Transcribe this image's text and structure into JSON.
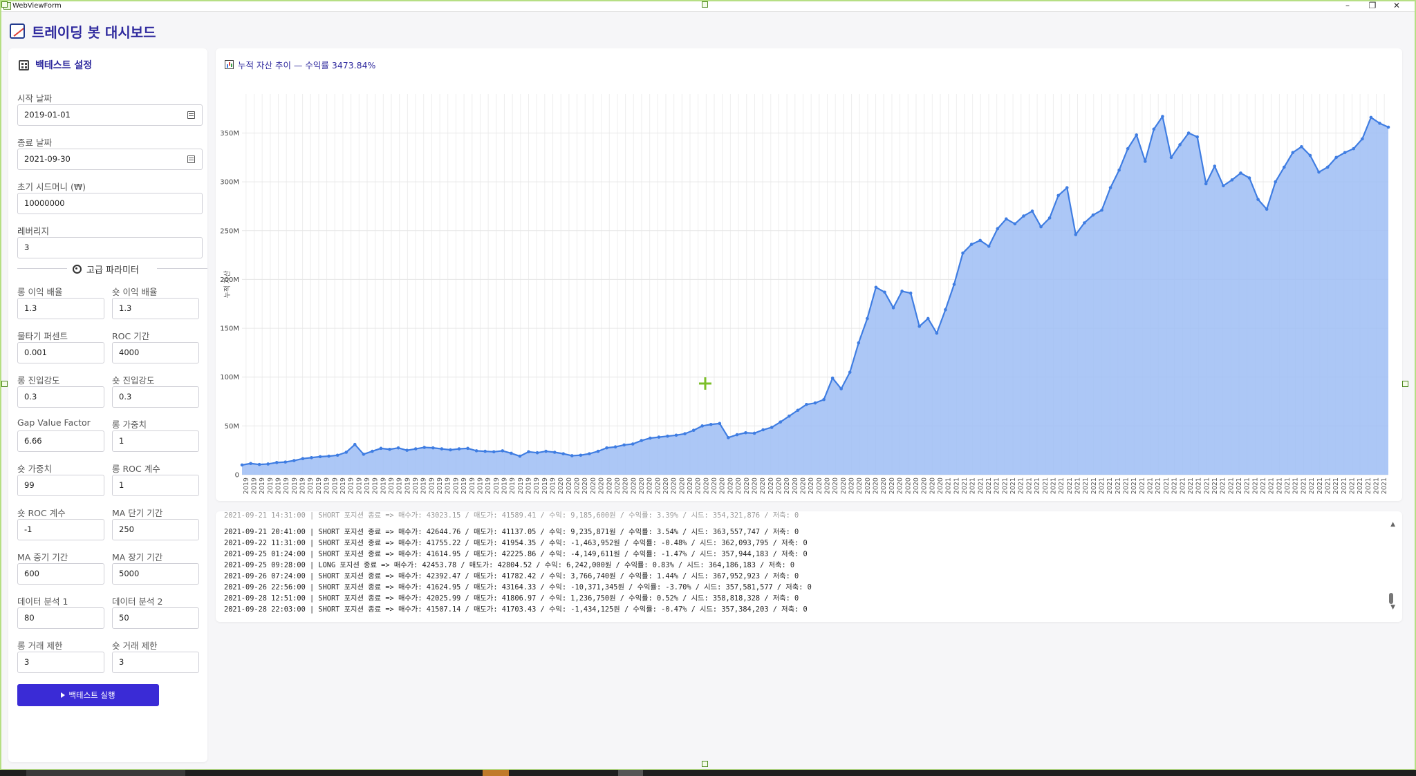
{
  "window": {
    "title": "WebViewForm",
    "minimize": "–",
    "restore": "❐",
    "close": "✕"
  },
  "app": {
    "title": "트레이딩 봇 대시보드"
  },
  "sidebar": {
    "title": "백테스트 설정",
    "start_date": {
      "label": "시작 날짜",
      "value": "2019-01-01"
    },
    "end_date": {
      "label": "종료 날짜",
      "value": "2021-09-30"
    },
    "seed": {
      "label": "초기 시드머니 (₩)",
      "value": "10000000"
    },
    "leverage": {
      "label": "레버리지",
      "value": "3"
    },
    "advanced_label": "고급 파라미터",
    "params": [
      {
        "label": "롱 이익 배율",
        "value": "1.3"
      },
      {
        "label": "숏 이익 배율",
        "value": "1.3"
      },
      {
        "label": "물타기 퍼센트",
        "value": "0.001"
      },
      {
        "label": "ROC 기간",
        "value": "4000"
      },
      {
        "label": "롱 진입강도",
        "value": "0.3"
      },
      {
        "label": "숏 진입강도",
        "value": "0.3"
      },
      {
        "label": "Gap Value Factor",
        "value": "6.66"
      },
      {
        "label": "롱 가중치",
        "value": "1"
      },
      {
        "label": "숏 가중치",
        "value": "99"
      },
      {
        "label": "롱 ROC 계수",
        "value": "1"
      },
      {
        "label": "숏 ROC 계수",
        "value": "-1"
      },
      {
        "label": "MA 단기 기간",
        "value": "250"
      },
      {
        "label": "MA 중기 기간",
        "value": "600"
      },
      {
        "label": "MA 장기 기간",
        "value": "5000"
      },
      {
        "label": "데이터 분석 1",
        "value": "80"
      },
      {
        "label": "데이터 분석 2",
        "value": "50"
      },
      {
        "label": "롱 거래 제한",
        "value": "3"
      },
      {
        "label": "숏 거래 제한",
        "value": "3"
      }
    ],
    "run_button": "백테스트 실행"
  },
  "chart_panel": {
    "title": "누적 자산 추이 — 수익률 3473.84%"
  },
  "chart_data": {
    "type": "area",
    "title": "누적 자산 추이 — 수익률 3473.84%",
    "ylabel": "누적 자산",
    "xlabel": "",
    "ylim": [
      0,
      390000000
    ],
    "yticks": [
      0,
      50000000,
      100000000,
      150000000,
      200000000,
      250000000,
      300000000,
      350000000
    ],
    "ytick_labels": [
      "0",
      "50M",
      "100M",
      "150M",
      "200M",
      "250M",
      "300M",
      "350M"
    ],
    "grid": true,
    "series_color": "#3f7de2",
    "fill_color": "#9ebdf5",
    "x_labels": [
      "2019",
      "2019",
      "2019",
      "2019",
      "2019",
      "2019",
      "2019",
      "2019",
      "2019",
      "2019",
      "2019",
      "2019",
      "2019",
      "2019",
      "2019",
      "2019",
      "2019",
      "2019",
      "2019",
      "2019",
      "2019",
      "2019",
      "2019",
      "2019",
      "2019",
      "2019",
      "2019",
      "2019",
      "2019",
      "2019",
      "2019",
      "2019",
      "2019",
      "2019",
      "2019",
      "2019",
      "2019",
      "2019",
      "2019",
      "2020",
      "2020",
      "2020",
      "2020",
      "2020",
      "2020",
      "2020",
      "2020",
      "2020",
      "2020",
      "2020",
      "2020",
      "2020",
      "2020",
      "2020",
      "2020",
      "2020",
      "2020",
      "2020",
      "2020",
      "2020",
      "2020",
      "2020",
      "2020",
      "2020",
      "2020",
      "2020",
      "2020",
      "2020",
      "2020",
      "2020",
      "2020",
      "2020",
      "2020",
      "2020",
      "2020",
      "2020",
      "2020",
      "2020",
      "2020",
      "2020",
      "2020",
      "2020",
      "2020",
      "2020",
      "2020",
      "2020",
      "2020",
      "2021",
      "2021",
      "2021",
      "2021",
      "2021",
      "2021",
      "2021",
      "2021",
      "2021",
      "2021",
      "2021",
      "2021",
      "2021",
      "2021",
      "2021",
      "2021",
      "2021",
      "2021",
      "2021",
      "2021",
      "2021",
      "2021",
      "2021",
      "2021",
      "2021",
      "2021",
      "2021",
      "2021",
      "2021",
      "2021",
      "2021",
      "2021",
      "2021",
      "2021",
      "2021",
      "2021",
      "2021",
      "2021",
      "2021",
      "2021",
      "2021",
      "2021",
      "2021",
      "2021",
      "2021",
      "2021",
      "2021",
      "2021",
      "2021",
      "2021",
      "2021",
      "2021",
      "2021",
      "2021",
      "2021"
    ],
    "values": [
      10000000,
      11500000,
      10500000,
      11000000,
      12500000,
      13000000,
      14500000,
      16500000,
      17500000,
      18500000,
      19000000,
      20000000,
      23000000,
      31000000,
      21000000,
      24000000,
      27000000,
      26000000,
      27500000,
      25000000,
      26500000,
      28000000,
      27500000,
      26500000,
      25500000,
      26500000,
      27000000,
      24500000,
      24000000,
      23500000,
      24500000,
      22000000,
      19000000,
      23500000,
      22500000,
      24000000,
      23000000,
      21500000,
      19500000,
      20000000,
      21500000,
      24000000,
      27500000,
      28500000,
      30500000,
      31500000,
      35000000,
      37500000,
      38500000,
      39500000,
      40500000,
      42000000,
      45500000,
      50000000,
      51500000,
      52500000,
      38000000,
      41000000,
      43000000,
      42500000,
      46000000,
      48500000,
      54000000,
      60000000,
      66000000,
      72000000,
      73500000,
      77000000,
      99000000,
      88000000,
      105000000,
      135000000,
      160000000,
      192000000,
      187000000,
      171000000,
      188000000,
      186000000,
      152000000,
      160000000,
      145000000,
      169000000,
      195000000,
      227000000,
      236000000,
      240000000,
      234000000,
      252000000,
      262000000,
      257000000,
      265000000,
      270000000,
      254000000,
      263000000,
      286000000,
      294000000,
      246000000,
      258000000,
      266000000,
      271000000,
      294000000,
      312000000,
      334000000,
      348000000,
      321000000,
      354000000,
      367000000,
      325000000,
      338000000,
      350000000,
      346000000,
      298000000,
      316000000,
      296000000,
      302000000,
      309000000,
      304000000,
      282000000,
      272000000,
      300000000,
      315000000,
      330000000,
      336000000,
      327000000,
      310000000,
      315000000,
      325000000,
      330000000,
      334000000,
      344000000,
      366000000,
      360000000,
      356000000
    ]
  },
  "log": {
    "clipped_line": "2021-09-21 14:31:00 | SHORT 포지션 종료 => 매수가: 43023.15 / 매도가: 41589.41 / 수익: 9,185,600원 / 수익률: 3.39% / 시드: 354,321,876 / 저축: 0",
    "lines": [
      "2021-09-21 20:41:00 | SHORT 포지션 종료 => 매수가: 42644.76 / 매도가: 41137.05 / 수익: 9,235,871원 / 수익률: 3.54% / 시드: 363,557,747 / 저축: 0",
      "2021-09-22 11:31:00 | SHORT 포지션 종료 => 매수가: 41755.22 / 매도가: 41954.35 / 수익: -1,463,952원 / 수익률: -0.48% / 시드: 362,093,795 / 저축: 0",
      "2021-09-25 01:24:00 | SHORT 포지션 종료 => 매수가: 41614.95 / 매도가: 42225.86 / 수익: -4,149,611원 / 수익률: -1.47% / 시드: 357,944,183 / 저축: 0",
      "2021-09-25 09:28:00 | LONG 포지션 종료 => 매수가: 42453.78 / 매도가: 42804.52 / 수익: 6,242,000원 / 수익률: 0.83% / 시드: 364,186,183 / 저축: 0",
      "2021-09-26 07:24:00 | SHORT 포지션 종료 => 매수가: 42392.47 / 매도가: 41782.42 / 수익: 3,766,740원 / 수익률: 1.44% / 시드: 367,952,923 / 저축: 0",
      "2021-09-26 22:56:00 | SHORT 포지션 종료 => 매수가: 41624.95 / 매도가: 43164.33 / 수익: -10,371,345원 / 수익률: -3.70% / 시드: 357,581,577 / 저축: 0",
      "2021-09-28 12:51:00 | SHORT 포지션 종료 => 매수가: 42025.99 / 매도가: 41806.97 / 수익: 1,236,750원 / 수익률: 0.52% / 시드: 358,818,328 / 저축: 0",
      "2021-09-28 22:03:00 | SHORT 포지션 종료 => 매수가: 41507.14 / 매도가: 41703.43 / 수익: -1,434,125원 / 수익률: -0.47% / 시드: 357,384,203 / 저축: 0"
    ]
  },
  "icons": {
    "app": "chart-trend-icon",
    "sidebar": "grid-icon",
    "advanced": "gear-icon",
    "chart": "bar-chart-icon",
    "move_cursor": "move-cursor-icon"
  }
}
